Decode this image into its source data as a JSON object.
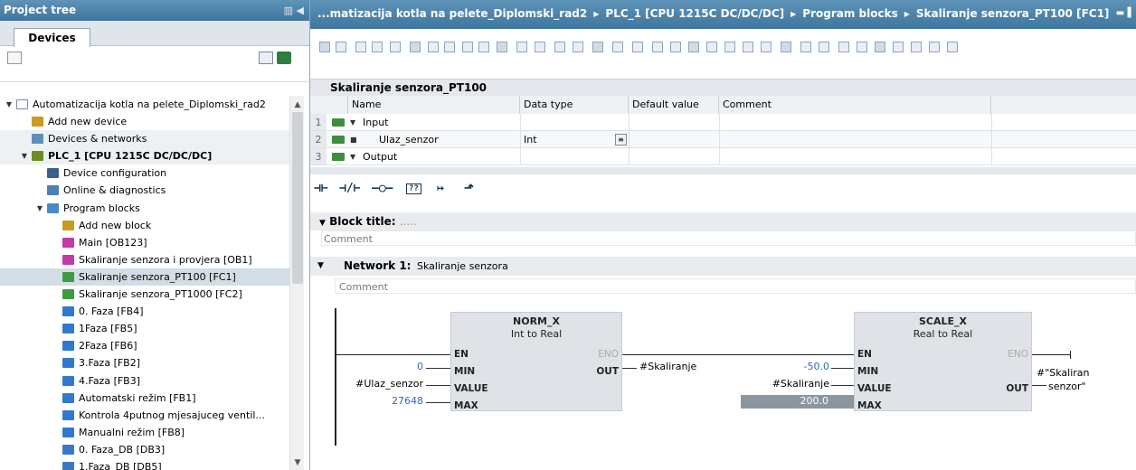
{
  "left": {
    "title": "Project tree",
    "tab": "Devices",
    "tree": [
      {
        "label": "Automatizacija kotla na pelete_Diplomski_rad2",
        "indent": 0,
        "tri": "▼",
        "icon": "project-icon",
        "color": "#ffffff",
        "bold": false
      },
      {
        "label": "Add new device",
        "indent": 1,
        "tri": "",
        "icon": "add-device-icon",
        "color": "#c89b22",
        "bold": false
      },
      {
        "label": "Devices & networks",
        "indent": 1,
        "tri": "",
        "icon": "network-icon",
        "color": "#5f8fb9",
        "bold": false
      },
      {
        "label": "PLC_1 [CPU 1215C DC/DC/DC]",
        "indent": 1,
        "tri": "▼",
        "icon": "plc-icon",
        "color": "#6b8e23",
        "bold": true
      },
      {
        "label": "Device configuration",
        "indent": 2,
        "tri": "",
        "icon": "device-config-icon",
        "color": "#3a5f8a",
        "bold": false
      },
      {
        "label": "Online & diagnostics",
        "indent": 2,
        "tri": "",
        "icon": "diagnostics-icon",
        "color": "#4f7fb0",
        "bold": false
      },
      {
        "label": "Program blocks",
        "indent": 2,
        "tri": "▼",
        "icon": "folder-icon",
        "color": "#4a89c5",
        "bold": false
      },
      {
        "label": "Add new block",
        "indent": 3,
        "tri": "",
        "icon": "add-block-icon",
        "color": "#c89b22",
        "bold": false
      },
      {
        "label": "Main [OB123]",
        "indent": 3,
        "tri": "",
        "icon": "ob-icon",
        "color": "#c23aa8",
        "bold": false
      },
      {
        "label": "Skaliranje senzora i provjera [OB1]",
        "indent": 3,
        "tri": "",
        "icon": "ob-icon",
        "color": "#c23aa8",
        "bold": false
      },
      {
        "label": "Skaliranje senzora_PT100 [FC1]",
        "indent": 3,
        "tri": "",
        "icon": "fc-icon",
        "color": "#3f9b3f",
        "bold": false,
        "selected": true
      },
      {
        "label": "Skaliranje senzora_PT1000 [FC2]",
        "indent": 3,
        "tri": "",
        "icon": "fc-icon",
        "color": "#3f9b3f",
        "bold": false
      },
      {
        "label": "0. Faza [FB4]",
        "indent": 3,
        "tri": "",
        "icon": "fb-icon",
        "color": "#2f7ad0",
        "bold": false
      },
      {
        "label": "1Faza [FB5]",
        "indent": 3,
        "tri": "",
        "icon": "fb-icon",
        "color": "#2f7ad0",
        "bold": false
      },
      {
        "label": "2Faza [FB6]",
        "indent": 3,
        "tri": "",
        "icon": "fb-icon",
        "color": "#2f7ad0",
        "bold": false
      },
      {
        "label": "3.Faza [FB2]",
        "indent": 3,
        "tri": "",
        "icon": "fb-icon",
        "color": "#2f7ad0",
        "bold": false
      },
      {
        "label": "4.Faza [FB3]",
        "indent": 3,
        "tri": "",
        "icon": "fb-icon",
        "color": "#2f7ad0",
        "bold": false
      },
      {
        "label": "Automatski režim [FB1]",
        "indent": 3,
        "tri": "",
        "icon": "fb-icon",
        "color": "#2f7ad0",
        "bold": false
      },
      {
        "label": "Kontrola 4putnog mjesajuceg ventil...",
        "indent": 3,
        "tri": "",
        "icon": "fb-icon",
        "color": "#2f7ad0",
        "bold": false
      },
      {
        "label": "Manualni režim [FB8]",
        "indent": 3,
        "tri": "",
        "icon": "fb-icon",
        "color": "#2f7ad0",
        "bold": false
      },
      {
        "label": "0. Faza_DB [DB3]",
        "indent": 3,
        "tri": "",
        "icon": "db-icon",
        "color": "#3b78c4",
        "bold": false
      },
      {
        "label": "1.Faza_DB [DB5]",
        "indent": 3,
        "tri": "",
        "icon": "db-icon",
        "color": "#3b78c4",
        "bold": false
      }
    ]
  },
  "breadcrumb": {
    "parts": [
      "...matizacija kotla na pelete_Diplomski_rad2",
      "PLC_1 [CPU 1215C DC/DC/DC]",
      "Program blocks",
      "Skaliranje senzora_PT100 [FC1]"
    ]
  },
  "interface": {
    "title": "Skaliranje senzora_PT100",
    "headers": {
      "name": "Name",
      "type": "Data type",
      "default": "Default value",
      "comment": "Comment"
    },
    "rows": [
      {
        "num": "1",
        "name": "Input",
        "type": "",
        "tri": "▼"
      },
      {
        "num": "2",
        "name": "Ulaz_senzor",
        "type": "Int",
        "tri": "■"
      },
      {
        "num": "3",
        "name": "Output",
        "type": "",
        "tri": "▼"
      }
    ]
  },
  "editor": {
    "block_title": "Block title:",
    "block_title_placeholder": ".....",
    "comment": "Comment",
    "network_label": "Network 1:",
    "network_title": "Skaliranje senzora",
    "network_comment": "Comment",
    "norm": {
      "name": "NORM_X",
      "sub": "Int to Real",
      "en": "EN",
      "eno": "ENO",
      "out_pin": "OUT",
      "min_pin": "MIN",
      "value_pin": "VALUE",
      "max_pin": "MAX",
      "min": "0",
      "value": "#Ulaz_senzor",
      "max": "27648",
      "out": "#Skaliranje"
    },
    "scale": {
      "name": "SCALE_X",
      "sub": "Real to Real",
      "en": "EN",
      "eno": "ENO",
      "out_pin": "OUT",
      "min_pin": "MIN",
      "value_pin": "VALUE",
      "max_pin": "MAX",
      "min": "-50.0",
      "value": "#Skaliranje",
      "max": "200.0",
      "out1": "#\"Skaliran",
      "out2": "senzor\""
    }
  }
}
